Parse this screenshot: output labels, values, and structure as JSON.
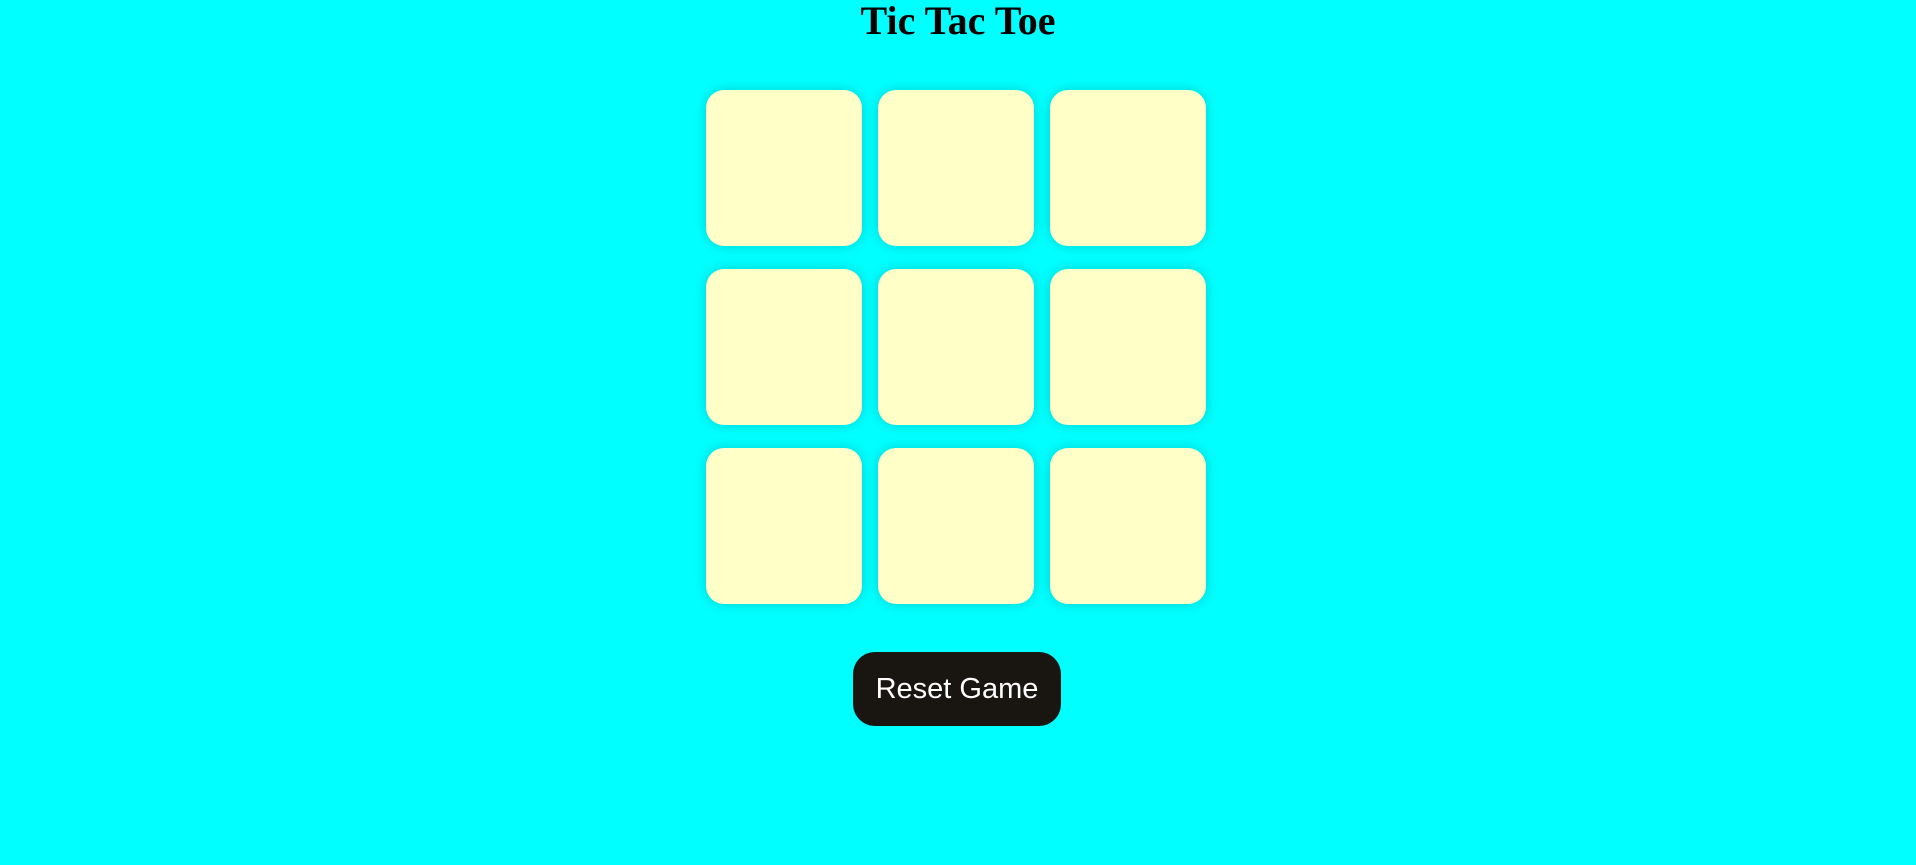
{
  "page": {
    "title": "Tic Tac Toe",
    "background_color": "#00ffff"
  },
  "board": {
    "cell_color": "#ffffc8",
    "cells": [
      "",
      "",
      "",
      "",
      "",
      "",
      "",
      "",
      ""
    ]
  },
  "controls": {
    "reset_label": "Reset Game",
    "reset_color": "#191612"
  }
}
